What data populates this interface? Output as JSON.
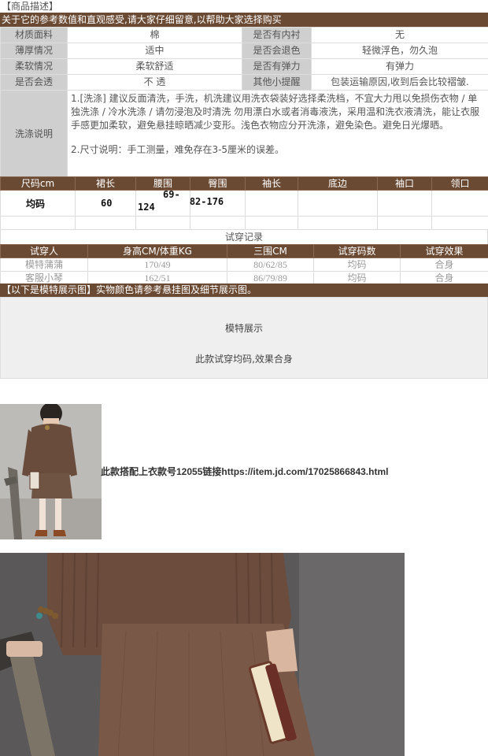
{
  "header": {
    "section_tag": "【商品描述】",
    "intro": "关于它的参考数值和直观感受,请大家仔细留意,以帮助大家选择购买"
  },
  "attributes": {
    "rows": [
      {
        "k1": "材质面料",
        "v1": "棉",
        "k2": "是否有内衬",
        "v2": "无"
      },
      {
        "k1": "薄厚情况",
        "v1": "适中",
        "k2": "是否会退色",
        "v2": "轻微浮色，勿久泡"
      },
      {
        "k1": "柔软情况",
        "v1": "柔软舒适",
        "k2": "是否有弹力",
        "v2": "有弹力"
      },
      {
        "k1": "是否会透",
        "v1": "不  透",
        "k2": "其他小提醒",
        "v2": "包装运输原因,收到后会比较褶皱."
      }
    ],
    "wash_label": "洗涤说明",
    "wash_p1": "1.[洗涤] 建议反面清洗，手洗，机洗建议用洗衣袋装好选择柔洗档，不宜大力甩以免损伤衣物 / 单独洗涤 / 冷水洗涤 / 请勿浸泡及时清洗 勿用漂白水或者消毒液洗，采用温和洗衣液清洗，能让衣服手感更加柔软，避免悬挂晾晒减少变形。浅色衣物应分开洗涤，避免染色。避免日光爆晒。",
    "wash_p2": "2.尺寸说明：手工测量，难免存在3-5厘米的误差。"
  },
  "size_table": {
    "headers": [
      "尺码cm",
      "裙长",
      "腰围",
      "臀围",
      "袖长",
      "底边",
      "袖口",
      "领口"
    ],
    "row": {
      "size": "均码",
      "length": "60",
      "waist_a": "69-",
      "waist_b": "124",
      "hip": "82-176"
    }
  },
  "trial": {
    "title": "试穿记录",
    "headers": [
      "试穿人",
      "身高CM/体重KG",
      "三围CM",
      "试穿码数",
      "试穿效果"
    ],
    "rows": [
      [
        "模特蒲蒲",
        "170/49",
        "80/62/85",
        "均码",
        "合身"
      ],
      [
        "客服小琴",
        "162/51",
        "86/79/89",
        "均码",
        "合身"
      ]
    ]
  },
  "model": {
    "bar": "【以下是模特展示图】实物颜色请参考悬挂图及细节展示图。",
    "title": "模特展示",
    "note": "此款试穿均码,效果合身"
  },
  "link_text": "此款搭配上衣款号12055链接https://item.jd.com/17025866843.html",
  "colors": {
    "brown_bar": "#6b4a33",
    "label_gray": "#cfcfcf",
    "knit_brown": "#7a5644"
  }
}
